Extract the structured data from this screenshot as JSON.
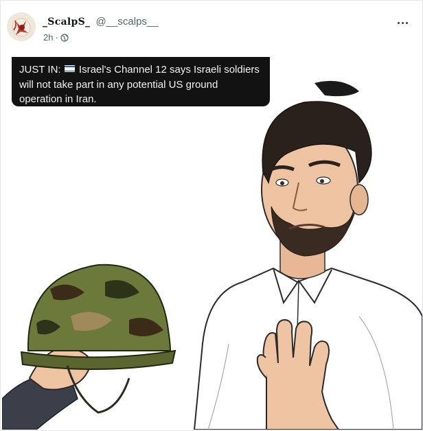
{
  "post": {
    "display_name": "_ScalpS_",
    "handle": "@__scalps__",
    "time": "2h",
    "separator": "·",
    "visibility_icon": "globe-icon",
    "more_icon": "more-options-icon",
    "avatar_icon": "avatar-image"
  },
  "media": {
    "caption_prefix": "JUST IN:",
    "caption_flag": "israel-flag-icon",
    "caption_body": "Israel's Channel 12 says Israeli soldiers will not take part in any potential US ground operation in Iran.",
    "illustration": "man-refusing-military-helmet"
  },
  "colors": {
    "caption_bg": "#121212",
    "caption_text": "#f2f2f2",
    "handle_text": "#536471",
    "helmet_camo": "#6b7a3a"
  }
}
